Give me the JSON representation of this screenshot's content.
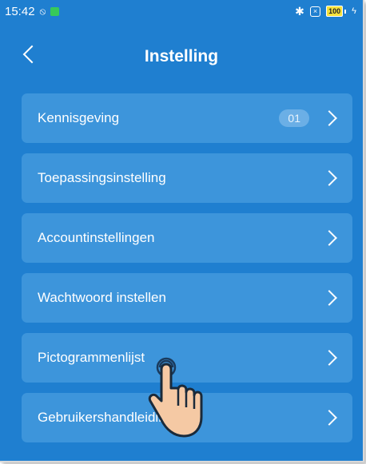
{
  "statusbar": {
    "time": "15:42",
    "battery": "100"
  },
  "header": {
    "title": "Instelling"
  },
  "menu": {
    "items": [
      {
        "label": "Kennisgeving",
        "badge": "01"
      },
      {
        "label": "Toepassingsinstelling"
      },
      {
        "label": "Accountinstellingen"
      },
      {
        "label": "Wachtwoord instellen"
      },
      {
        "label": "Pictogrammenlijst"
      },
      {
        "label": "Gebruikershandleiding"
      }
    ]
  },
  "colors": {
    "background": "#1f7fd0",
    "item": "#3d95db",
    "badge": "#6bafe6"
  }
}
